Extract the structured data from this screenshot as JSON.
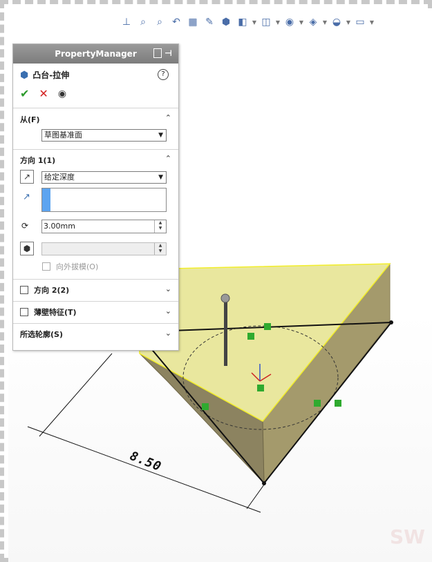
{
  "toolbar": {
    "icons": [
      "view-orientation-icon",
      "zoom-to-fit-icon",
      "zoom-area-icon",
      "previous-view-icon",
      "section-view-icon",
      "dynamic-annotation-icon",
      "view-cube-icon",
      "display-style-icon",
      "hide-show-icon",
      "edit-appearance-icon",
      "apply-scene-icon",
      "view-settings-icon",
      "display-icon"
    ]
  },
  "panel": {
    "title": "PropertyManager",
    "feature_name": "凸台-拉伸",
    "help": "?",
    "ok": "✔",
    "cancel": "✕",
    "from_label": "从(F)",
    "from_value": "草图基准面",
    "direction1_label": "方向 1(1)",
    "end_condition": "给定深度",
    "depth_value": "3.00mm",
    "draft_outward_label": "向外拔模(O)",
    "direction2_label": "方向 2(2)",
    "thin_feature_label": "薄壁特征(T)",
    "selected_contours_label": "所选轮廓(S)"
  },
  "scene": {
    "dimension_text": "8.50",
    "face_color": "#e9e79e",
    "side_color": "#a49a6c",
    "edge_color": "#f2ee2a"
  }
}
